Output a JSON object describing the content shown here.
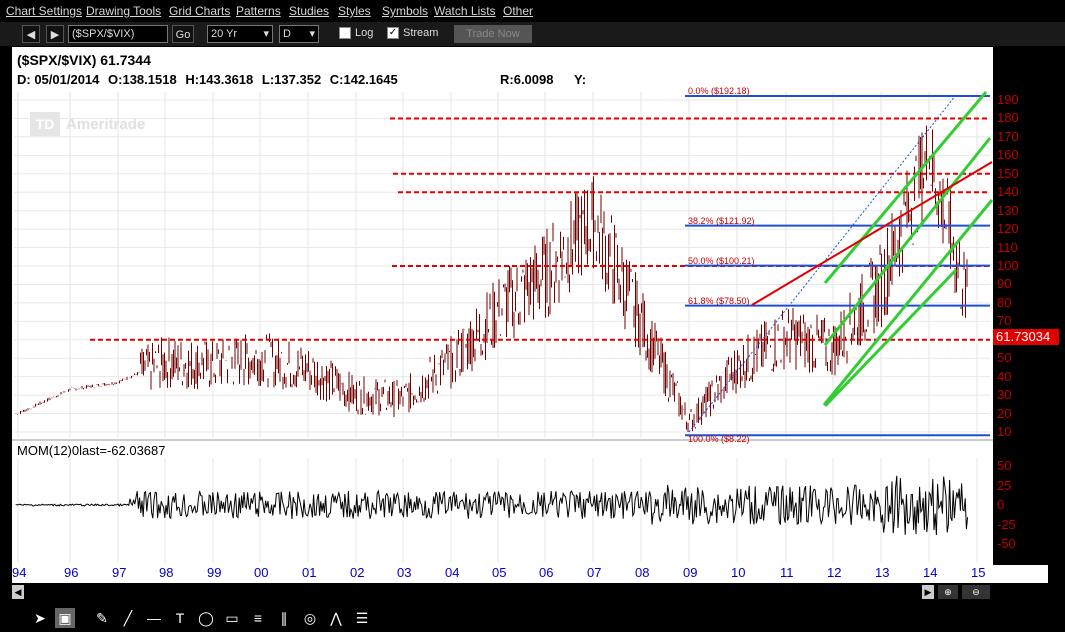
{
  "menu": [
    "Chart Settings",
    "Drawing Tools",
    "Grid Charts",
    "Patterns",
    "Studies",
    "Styles",
    "Symbols",
    "Watch Lists",
    "Other"
  ],
  "toolbar": {
    "symbol": "($SPX/$VIX)",
    "go": "Go",
    "period": "20 Yr",
    "interval": "D",
    "log_label": "Log",
    "log_checked": false,
    "stream_label": "Stream",
    "stream_checked": true,
    "trade_now": "Trade Now"
  },
  "header": {
    "title": "($SPX/$VIX)  61.7344",
    "date": "D: 05/01/2014",
    "open": "O:138.1518",
    "high": "H:143.3618",
    "low": "L:137.352",
    "close": "C:142.1645",
    "r": "R:6.0098",
    "y": "Y:"
  },
  "watermark": "Ameritrade",
  "watermark_logo": "TD",
  "momentum": {
    "label": "MOM(12)",
    "last": "0last=-62.03687",
    "ticks": [
      "50",
      "25",
      "0",
      "-25",
      "-50"
    ]
  },
  "y_ticks": [
    "190",
    "180",
    "170",
    "160",
    "150",
    "140",
    "130",
    "120",
    "110",
    "100",
    "90",
    "80",
    "70",
    "60",
    "50",
    "40",
    "30",
    "20",
    "10"
  ],
  "last_price": "61.73034",
  "x_ticks": [
    "94",
    "96",
    "97",
    "98",
    "99",
    "00",
    "01",
    "02",
    "03",
    "04",
    "05",
    "06",
    "07",
    "08",
    "09",
    "10",
    "11",
    "12",
    "13",
    "14",
    "15"
  ],
  "fib_labels": [
    "0.0%  ($192.18)",
    "38.2%  ($121.92)",
    "50.0%  ($100.21)",
    "61.8%  ($78.50)",
    "100.0%  ($8.22)"
  ],
  "colors": {
    "price": "#c00000",
    "support": "#e00000",
    "fib": "#1f4fd6",
    "channel": "#33cc33",
    "trend": "#e00000",
    "axis": "#c00000",
    "xaxis": "#0000cc"
  },
  "chart_data": {
    "type": "line",
    "series_name": "($SPX/$VIX)",
    "x": [
      "94",
      "96",
      "97",
      "98",
      "99",
      "00",
      "01",
      "02",
      "03",
      "04",
      "05",
      "06",
      "07",
      "08",
      "09",
      "10",
      "11",
      "12",
      "13",
      "14",
      "15"
    ],
    "y": [
      20,
      33,
      37,
      48,
      46,
      50,
      44,
      30,
      28,
      48,
      75,
      95,
      125,
      70,
      15,
      45,
      62,
      55,
      90,
      160,
      62
    ],
    "ylim": [
      10,
      195
    ],
    "support_levels": [
      180,
      150,
      140,
      100,
      60
    ],
    "fibonacci": [
      192.18,
      121.92,
      100.21,
      78.5,
      8.22
    ],
    "momentum": {
      "name": "MOM(12)",
      "last": -62.03687,
      "ylim": [
        -60,
        60
      ]
    }
  }
}
